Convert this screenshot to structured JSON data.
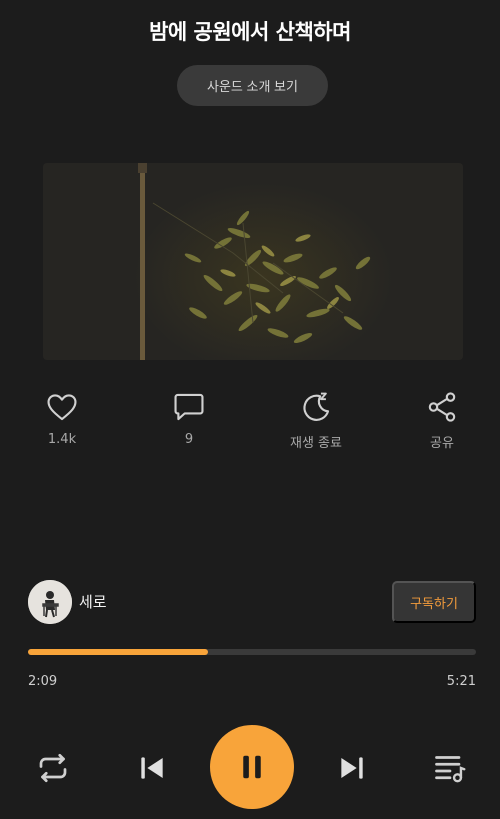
{
  "header": {
    "title": "밤에 공원에서 산책하며",
    "intro_button": "사운드 소개 보기"
  },
  "actions": {
    "like": {
      "label": "1.4k",
      "icon": "heart-icon"
    },
    "comment": {
      "label": "9",
      "icon": "comment-icon"
    },
    "sleep": {
      "label": "재생 종료",
      "icon": "moon-sleep-icon"
    },
    "share": {
      "label": "공유",
      "icon": "share-icon"
    }
  },
  "artist": {
    "name": "세로",
    "subscribe_label": "구독하기"
  },
  "player": {
    "current_time": "2:09",
    "total_time": "5:21",
    "progress_fraction": 0.402,
    "state": "playing"
  },
  "colors": {
    "accent": "#f8a43a",
    "background": "#1c1c1c",
    "icon": "#d0d0d0"
  }
}
